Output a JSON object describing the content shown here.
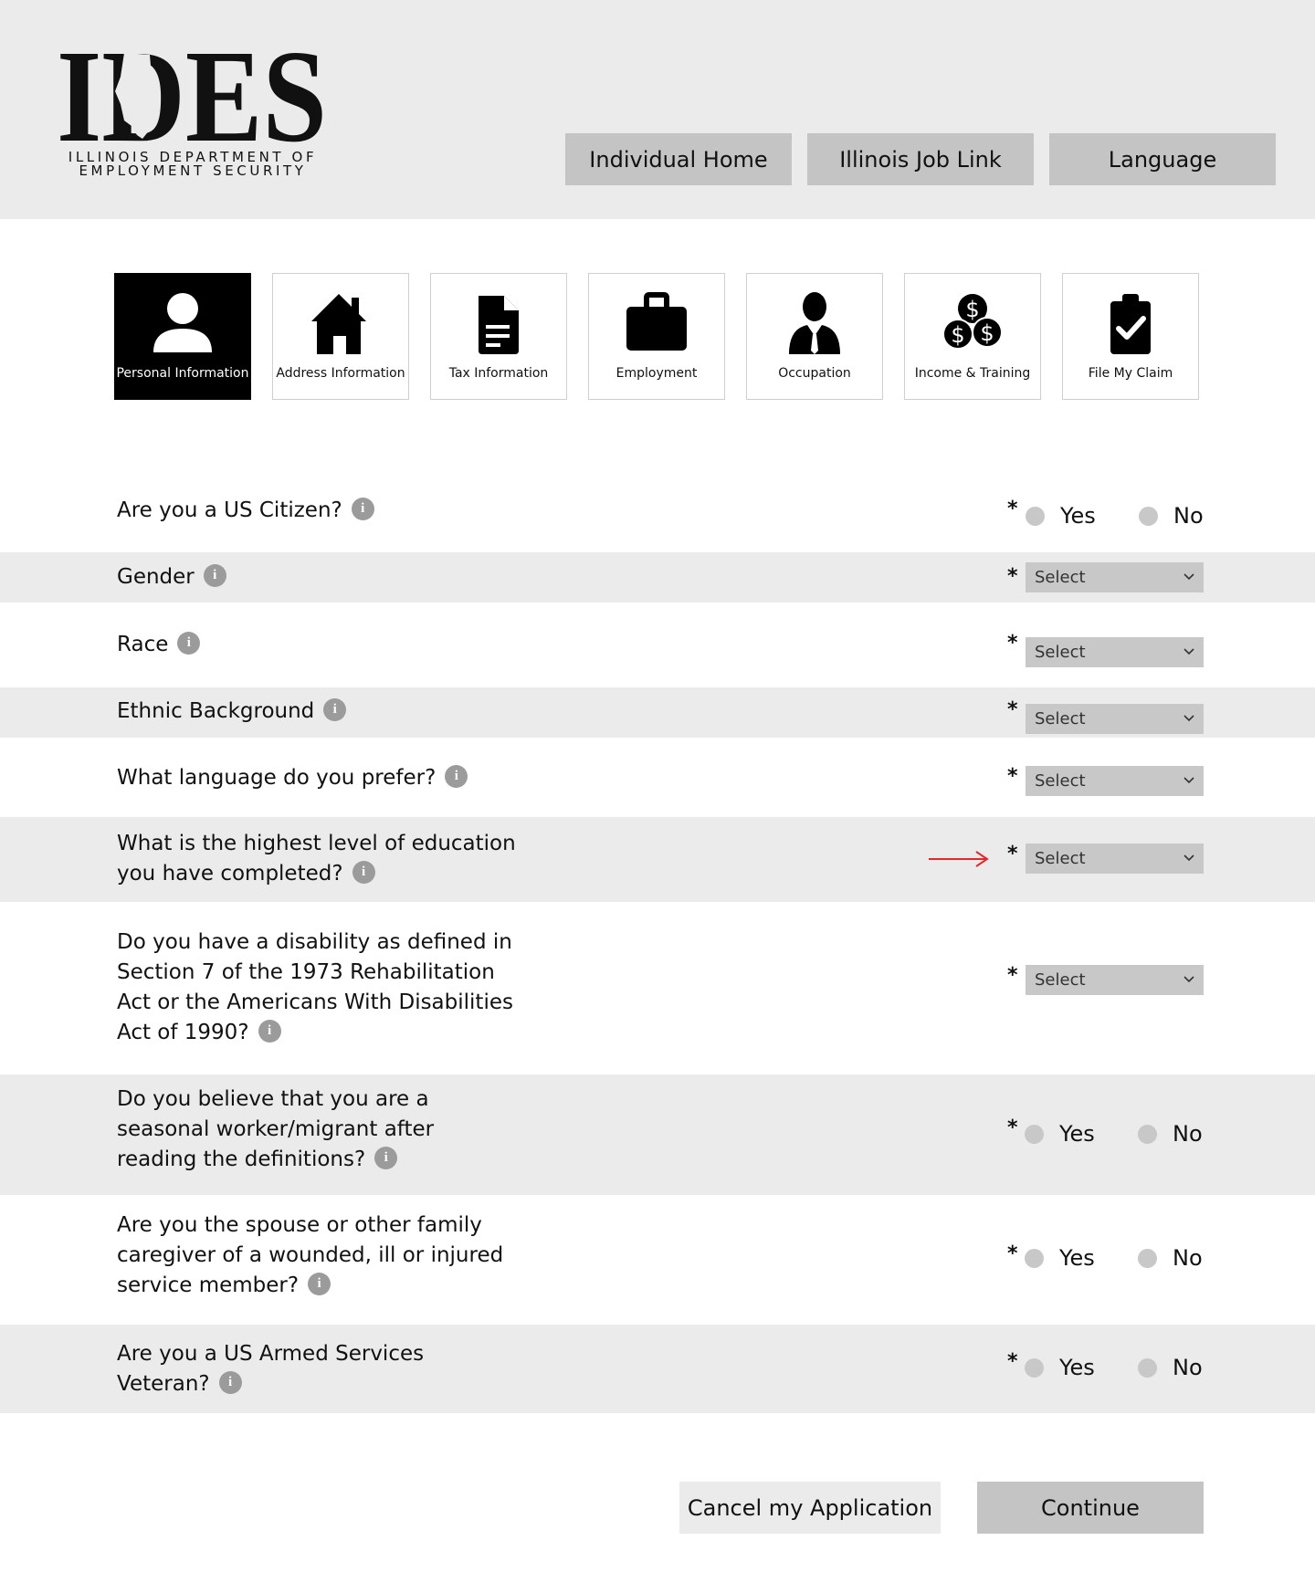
{
  "header": {
    "logo_text": "IDES",
    "logo_line1": "ILLINOIS DEPARTMENT OF",
    "logo_line2": "EMPLOYMENT SECURITY",
    "nav": [
      "Individual Home",
      "Illinois Job Link",
      "Language"
    ]
  },
  "steps": [
    {
      "label": "Personal Information",
      "icon": "person-icon",
      "active": true
    },
    {
      "label": "Address Information",
      "icon": "house-icon",
      "active": false
    },
    {
      "label": "Tax Information",
      "icon": "document-icon",
      "active": false
    },
    {
      "label": "Employment",
      "icon": "briefcase-icon",
      "active": false
    },
    {
      "label": "Occupation",
      "icon": "businessman-icon",
      "active": false
    },
    {
      "label": "Income & Training",
      "icon": "coins-icon",
      "active": false
    },
    {
      "label": "File My Claim",
      "icon": "clipboard-check-icon",
      "active": false
    }
  ],
  "form": {
    "required_mark": "*",
    "select_placeholder": "Select",
    "yes_label": "Yes",
    "no_label": "No",
    "info_glyph": "i",
    "questions": {
      "us_citizen": [
        "Are you a US Citizen?"
      ],
      "gender": [
        "Gender"
      ],
      "race": [
        "Race"
      ],
      "ethnic": [
        "Ethnic Background"
      ],
      "language": [
        "What language do you prefer?"
      ],
      "education": [
        "What is the highest level of education",
        "you have completed?"
      ],
      "disability": [
        "Do you have a disability as defined in",
        "Section 7 of the 1973 Rehabilitation",
        "Act or the Americans With Disabilities",
        "Act of 1990?"
      ],
      "seasonal": [
        "Do you believe that you are a",
        "seasonal worker/migrant after",
        "reading the definitions?"
      ],
      "caregiver": [
        "Are you the spouse or other family",
        "caregiver of a wounded, ill or injured",
        "service member?"
      ],
      "veteran": [
        "Are you a US Armed Services",
        "Veteran?"
      ]
    }
  },
  "footer": {
    "cancel_label": "Cancel my Application",
    "continue_label": "Continue"
  },
  "colors": {
    "header_bg": "#ebebeb",
    "shade_row": "#ebebeb",
    "button_gray": "#c4c4c4",
    "active_step": "#000000",
    "arrow": "#e8262a"
  }
}
